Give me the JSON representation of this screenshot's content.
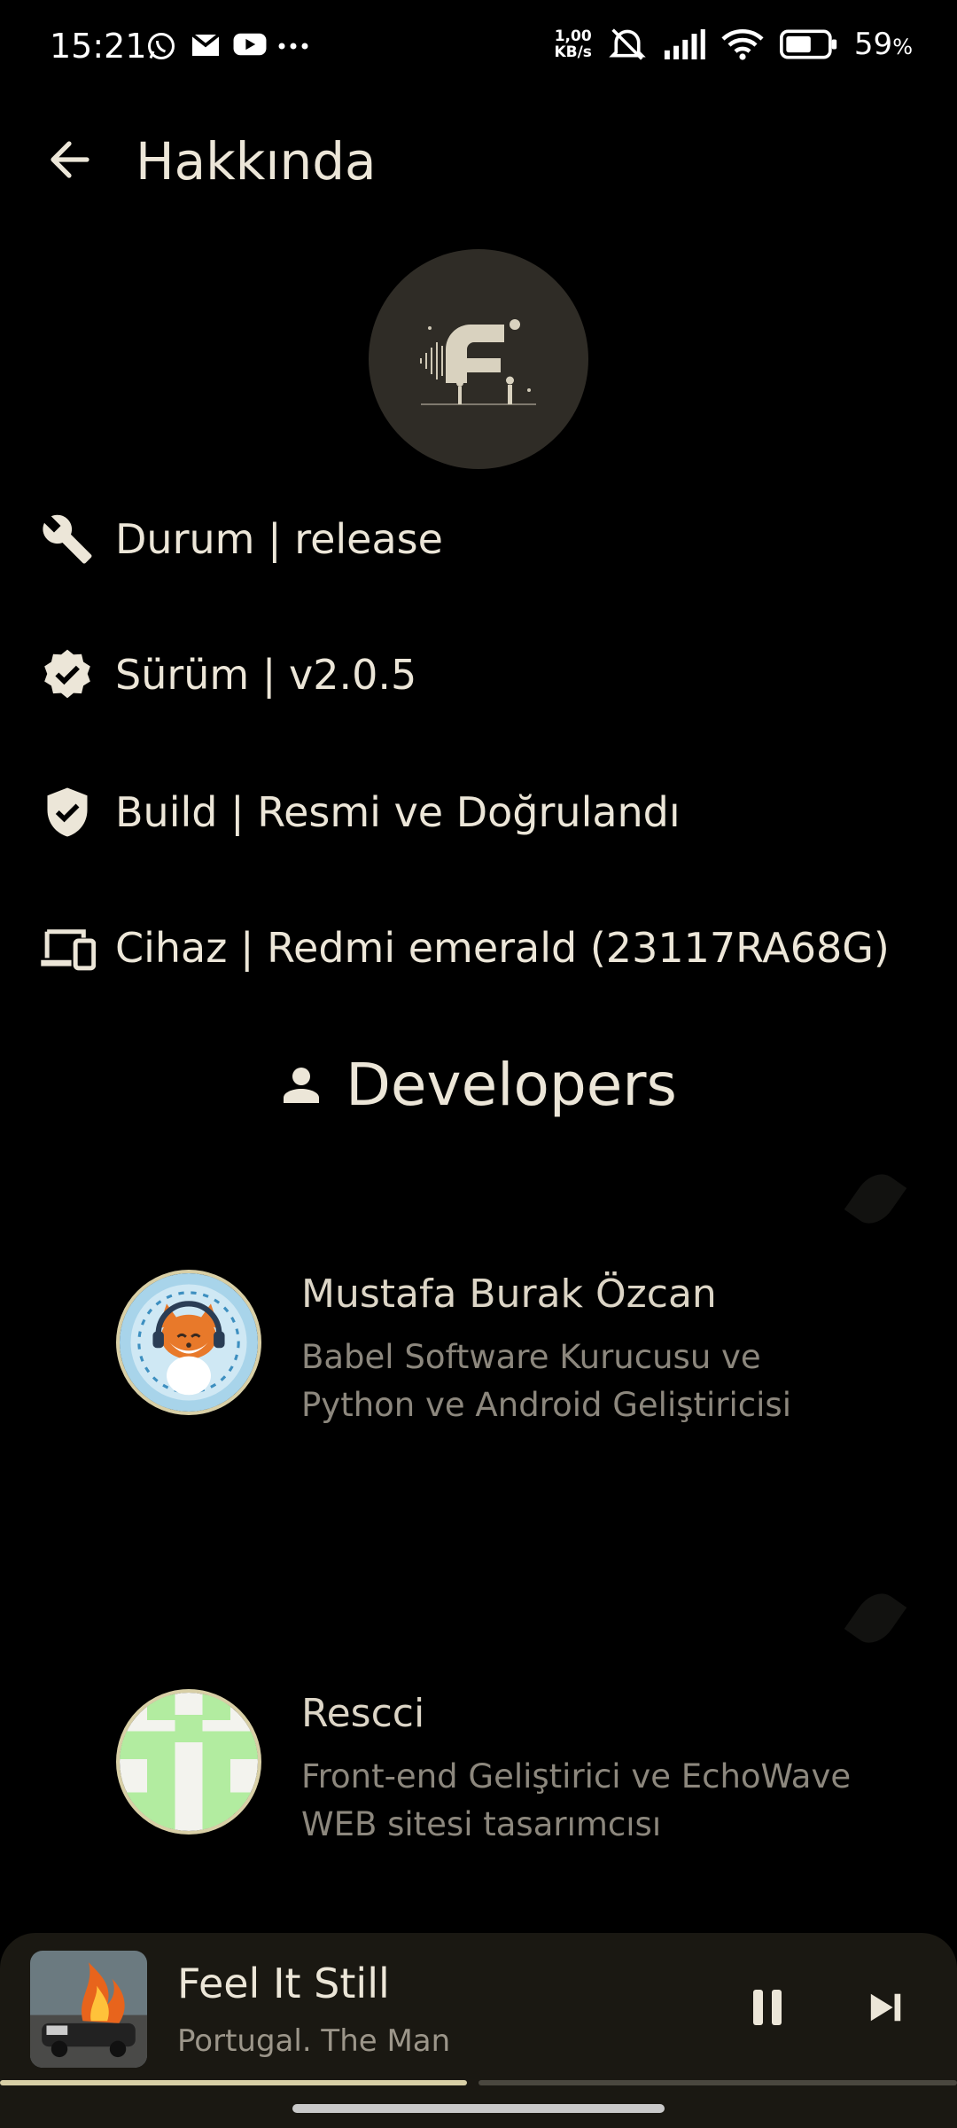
{
  "status_bar": {
    "time": "15:21",
    "net_speed_value": "1,00",
    "net_speed_unit": "KB/s",
    "battery_percent": "59",
    "battery_unit": "%",
    "notification_icons": [
      "whatsapp-icon",
      "gmail-icon",
      "youtube-icon",
      "more-dots-icon"
    ],
    "system_icons": [
      "mute-bell-icon",
      "signal-icon",
      "wifi-icon",
      "battery-icon"
    ]
  },
  "header": {
    "title": "Hakkında",
    "back_icon": "arrow-back-icon"
  },
  "info": [
    {
      "icon": "wrench-icon",
      "text": "Durum | release"
    },
    {
      "icon": "verified-badge-icon",
      "text": "Sürüm | v2.0.5"
    },
    {
      "icon": "shield-check-icon",
      "text": "Build | Resmi ve Doğrulandı"
    },
    {
      "icon": "devices-icon",
      "text": "Cihaz | Redmi emerald (23117RA68G)"
    }
  ],
  "developers": {
    "heading": "Developers",
    "items": [
      {
        "name": "Mustafa Burak Özcan",
        "desc_line1": "Babel Software Kurucusu ve",
        "desc_line2": "Python ve Android Geliştiricisi"
      },
      {
        "name": "Rescci",
        "desc_line1": "Front-end Geliştirici ve EchoWave",
        "desc_line2": "WEB sitesi tasarımcısı"
      }
    ]
  },
  "player": {
    "title": "Feel It Still",
    "artist": "Portugal. The Man",
    "progress": 0.49,
    "accent": "#d8cfa6"
  },
  "colors": {
    "background": "#000000",
    "text": "#ece6d8",
    "muted": "#8c877d",
    "logo_bg": "#2f2c26",
    "player_bg": "#1a1812"
  }
}
